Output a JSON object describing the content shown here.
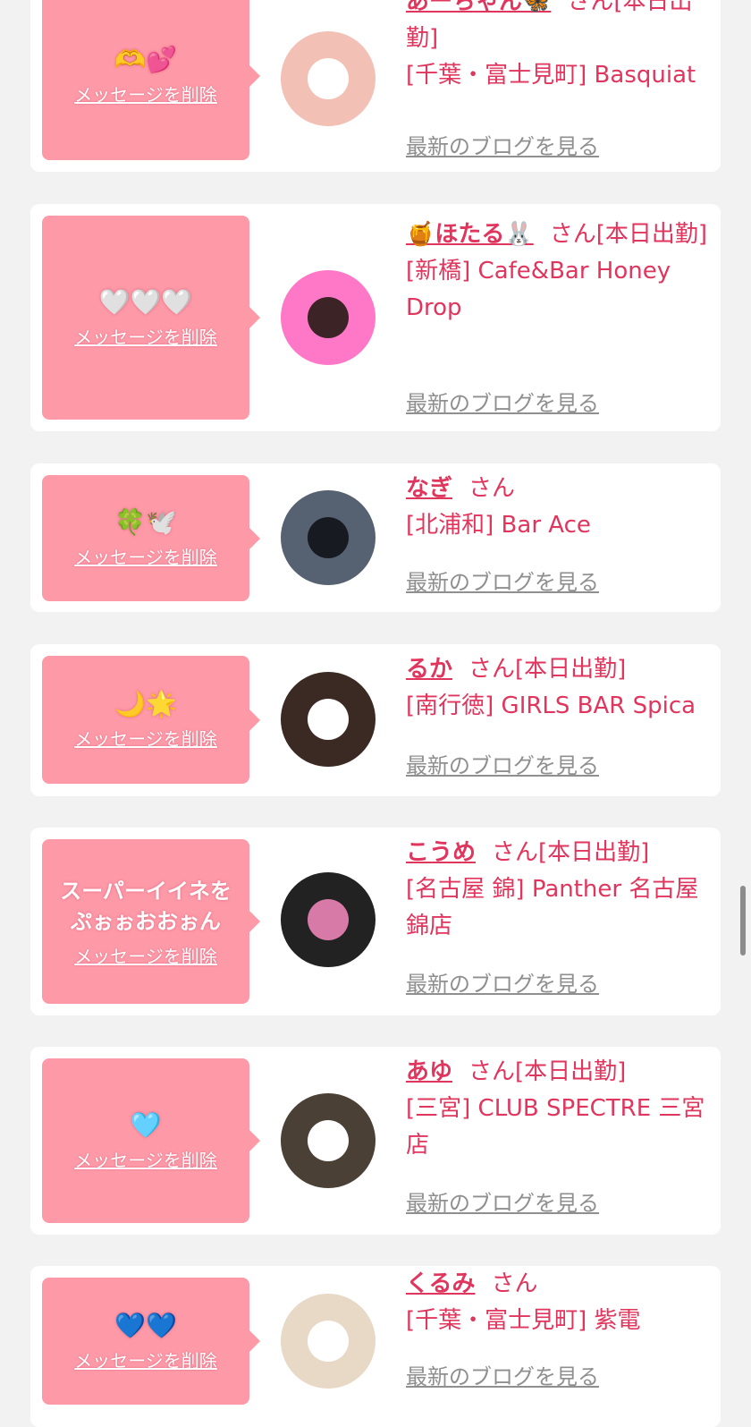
{
  "delete_label": "メッセージを削除",
  "blog_label": "最新のブログを見る",
  "san": "さん",
  "cards": [
    {
      "message": "🫶💕",
      "name": "あーちゃん🦋",
      "suffix": "[本日出勤]",
      "shop": "[千葉・富士見町] Basquiat",
      "avatar_colors": [
        "#f3c0b6",
        "#ffffff"
      ]
    },
    {
      "message": "🤍🤍🤍",
      "name": "🍯ほたる🐰",
      "suffix": "[本日出勤]",
      "shop": "[新橋] Cafe&Bar Honey Drop",
      "avatar_colors": [
        "#ff78c8",
        "#3b2326"
      ]
    },
    {
      "message": "🍀🕊️",
      "name": "なぎ",
      "suffix": "",
      "shop": "[北浦和] Bar Ace",
      "avatar_colors": [
        "#566171",
        "#171a21"
      ]
    },
    {
      "message": "🌙🌟",
      "name": "るか",
      "suffix": "[本日出勤]",
      "shop": "[南行徳] GIRLS BAR Spica",
      "avatar_colors": [
        "#3b2a24",
        "#ffffff"
      ]
    },
    {
      "message": "スーパーイイネを\nぷぉぉおおぉん",
      "name": "こうめ",
      "suffix": "[本日出勤]",
      "shop": "[名古屋 錦] Panther 名古屋錦店",
      "avatar_colors": [
        "#222222",
        "#d87aa8"
      ]
    },
    {
      "message": "🩵",
      "name": "あゆ",
      "suffix": "[本日出勤]",
      "shop": "[三宮] CLUB SPECTRE 三宮店",
      "avatar_colors": [
        "#4a4036",
        "#ffffff"
      ]
    },
    {
      "message": "💙💙",
      "name": "くるみ",
      "suffix": "",
      "shop": "[千葉・富士見町] 紫電",
      "avatar_colors": [
        "#e8d8c6",
        "#ffffff"
      ]
    }
  ]
}
